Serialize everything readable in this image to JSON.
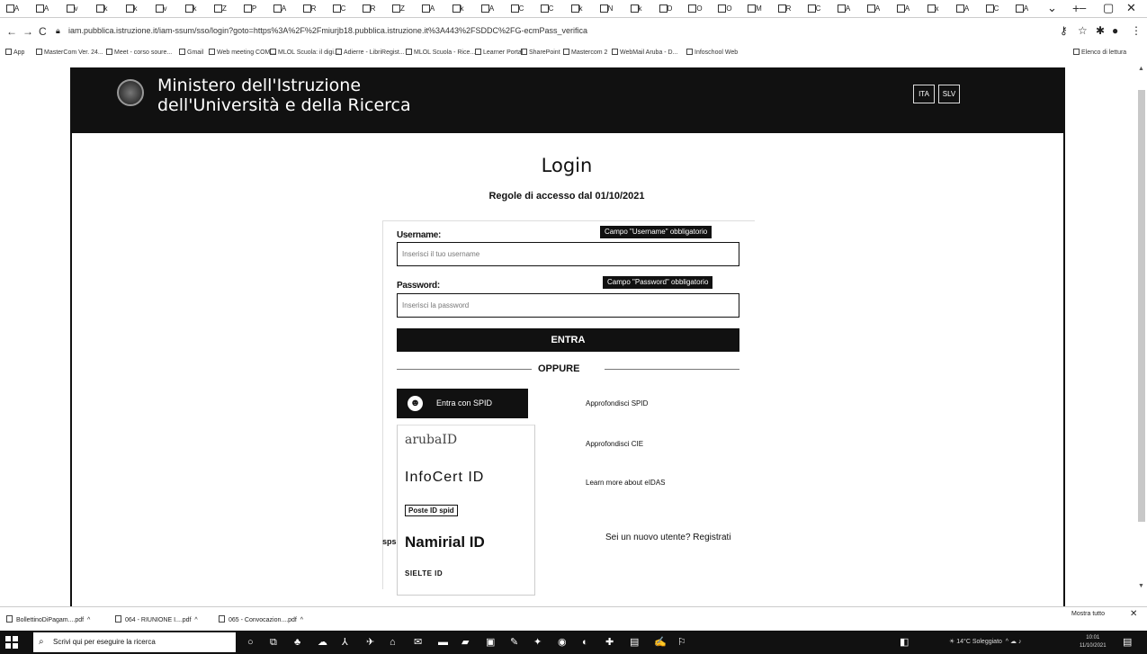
{
  "browser": {
    "url": "iam.pubblica.istruzione.it/iam-ssum/sso/login?goto=https%3A%2F%2Fmiurjb18.pubblica.istruzione.it%3A443%2FSDDC%2FG-ecmPass_verifica",
    "tab_letters": [
      "A",
      "A",
      "v",
      "k",
      "k",
      "v",
      "k",
      "Z",
      "P",
      "A",
      "R",
      "C",
      "R",
      "Z",
      "A",
      "k",
      "A",
      "C",
      "C",
      "k",
      "N",
      "k",
      "D",
      "O",
      "O",
      "M",
      "R",
      "C",
      "A",
      "A",
      "A",
      "x",
      "A",
      "C",
      "A"
    ],
    "new_tab": "+",
    "window_controls": {
      "chevron": "⌄",
      "minimize": "–",
      "maximize": "▢",
      "close": "✕"
    },
    "nav": {
      "back": "←",
      "forward": "→",
      "reload": "C"
    },
    "bookmarks": [
      "App",
      "MasterCom Ver. 24...",
      "Meet - corso soure...",
      "Gmail",
      "Web meeting COM...",
      "MLOL Scuola: il digi...",
      "Adierre - LibriRegist...",
      "MLOL Scuola - Rice...",
      "Learner Portal",
      "SharePoint",
      "Mastercom 2",
      "WebMail Aruba - D...",
      "Infoschool Web"
    ],
    "reading_list": "Elenco di lettura"
  },
  "header": {
    "ministry_line1": "Ministero dell'Istruzione",
    "ministry_line2": "dell'Università e della Ricerca",
    "lang_it": "ITA",
    "lang_sl": "SLV"
  },
  "login": {
    "title": "Login",
    "access_rules": "Regole di accesso dal 01/10/2021",
    "username_label": "Username:",
    "username_required": "Campo \"Username\" obbligatorio",
    "username_placeholder": "Inserisci il tuo username",
    "password_label": "Password:",
    "password_required": "Campo \"Password\" obbligatorio",
    "password_placeholder": "Inserisci la password",
    "enter_button": "ENTRA",
    "or_label": "OPPURE",
    "spid_button": "Entra con SPID",
    "providers": [
      "arubaID",
      "InfoCert ID",
      "Poste ID spid",
      "Namirial ID",
      "SIELTE ID"
    ],
    "info_spid": "Approfondisci SPID",
    "info_cie": "Approfondisci CIE",
    "info_eidas": "Learn more about eIDAS",
    "register": "Sei un nuovo utente? Registrati",
    "sps_fragment": "sps"
  },
  "downloads": {
    "files": [
      "BollettinoDiPagam....pdf",
      "064 - RIUNIONE I....pdf",
      "065 - Convocazion....pdf"
    ],
    "show_all": "Mostra tutto",
    "close": "✕"
  },
  "taskbar": {
    "search_placeholder": "Scrivi qui per eseguire la ricerca",
    "weather": "14°C Soleggiato",
    "time": "10:01",
    "date": "11/10/2021"
  }
}
